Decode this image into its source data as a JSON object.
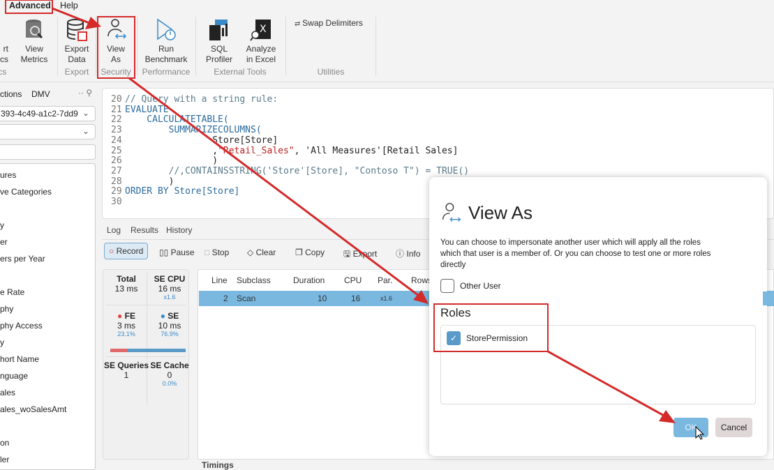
{
  "menu": {
    "items": [
      "Advanced",
      "Help"
    ]
  },
  "ribbon": {
    "buttons": [
      {
        "label1": "rt",
        "label2": "ics",
        "icon": "export-metrics-icon"
      },
      {
        "label1": "View",
        "label2": "Metrics",
        "icon": "view-metrics-icon"
      },
      {
        "label1": "Export",
        "label2": "Data",
        "icon": "export-data-icon"
      },
      {
        "label1": "View",
        "label2": "As",
        "icon": "view-as-icon"
      },
      {
        "label1": "Run",
        "label2": "Benchmark",
        "icon": "run-benchmark-icon"
      },
      {
        "label1": "SQL",
        "label2": "Profiler",
        "icon": "sql-profiler-icon"
      },
      {
        "label1": "Analyze",
        "label2": "in Excel",
        "icon": "excel-icon"
      }
    ],
    "swap_delimiters": "Swap Delimiters",
    "groups": [
      "ics",
      "Export",
      "Security",
      "Performance",
      "External Tools",
      "Utilities"
    ]
  },
  "sidebar": {
    "tabs": [
      "ctions",
      "DMV"
    ],
    "database": "393-4c49-a1c2-7dd9",
    "items": [
      "ures",
      "ve Categories",
      "",
      "y",
      "er",
      "ers per Year",
      "",
      "e Rate",
      "phy",
      "phy Access",
      "y",
      "hort Name",
      "nguage",
      "ales",
      "ales_woSalesAmt",
      "",
      "on",
      "ler"
    ]
  },
  "editor": {
    "lines": [
      {
        "n": "20",
        "t": "// Query with a string rule:"
      },
      {
        "n": "21",
        "t": "EVALUATE"
      },
      {
        "n": "22",
        "t": "    CALCULATETABLE("
      },
      {
        "n": "23",
        "t": "        SUMMARIZECOLUMNS("
      },
      {
        "n": "24",
        "t": "                Store[Store]"
      },
      {
        "n": "25",
        "t": "                ,\"Retail_Sales\", 'All Measures'[Retail Sales]"
      },
      {
        "n": "26",
        "t": "                )"
      },
      {
        "n": "27",
        "t": "        //,CONTAINSSTRING('Store'[Store], \"Contoso T\") = TRUE()"
      },
      {
        "n": "28",
        "t": "        )"
      },
      {
        "n": "29",
        "t": "ORDER BY Store[Store]"
      },
      {
        "n": "30",
        "t": ""
      }
    ]
  },
  "output_tabs": [
    "Log",
    "Results",
    "History",
    "Server Timings"
  ],
  "toolbar": [
    "Record",
    "Pause",
    "Stop",
    "Clear",
    "Copy",
    "Export",
    "Info"
  ],
  "stats": {
    "total_label": "Total",
    "total": "13 ms",
    "secpu_label": "SE CPU",
    "secpu": "16 ms",
    "secpu_x": "x1.6",
    "fe_label": "FE",
    "fe": "3 ms",
    "fe_pct": "23.1%",
    "se_label": "SE",
    "se": "10 ms",
    "se_pct": "76.9%",
    "fe_fraction": 0.231,
    "seq_label": "SE Queries",
    "seq": "1",
    "secache_label": "SE Cache",
    "secache": "0",
    "secache_pct": "0.0%"
  },
  "grid": {
    "headers": [
      "Line",
      "Subclass",
      "Duration",
      "CPU",
      "Par.",
      "Rows"
    ],
    "rows": [
      {
        "line": "2",
        "subclass": "Scan",
        "duration": "10",
        "cpu": "16",
        "par": "x1.6"
      }
    ]
  },
  "dialog": {
    "title": "View As",
    "description": "You can choose to impersonate another user which will apply all the roles which that user is a member of. Or you can choose to test one or more roles directly",
    "other_user": "Other User",
    "roles_heading": "Roles",
    "roles": [
      {
        "name": "StorePermission",
        "checked": true
      }
    ],
    "ok": "OK",
    "cancel": "Cancel"
  },
  "colors": {
    "annotation": "#d42a2a",
    "accent": "#7ab8e0"
  }
}
